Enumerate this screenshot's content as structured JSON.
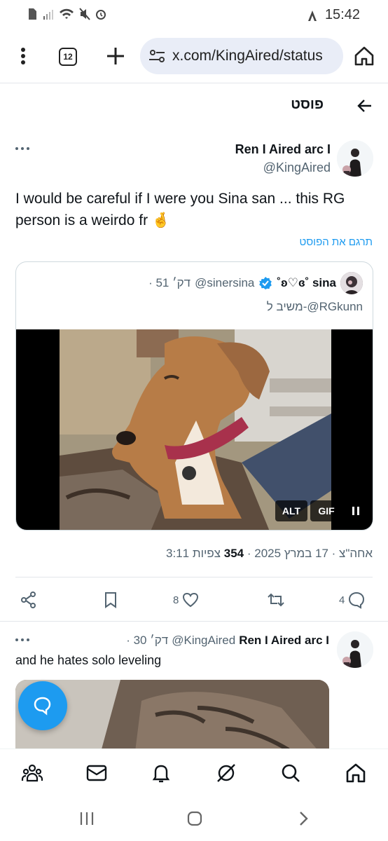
{
  "status_bar": {
    "time": "15:42",
    "icons": [
      "sim-icon",
      "signal-icon",
      "wifi-icon",
      "mute-icon",
      "alarm-icon",
      "autofill-icon"
    ]
  },
  "browser": {
    "tab_count": "12",
    "url": "x.com/KingAired/status",
    "icons": [
      "menu-dots-icon",
      "new-tab-plus-icon",
      "site-settings-icon",
      "home-icon"
    ]
  },
  "post_header": {
    "title": "פוסט",
    "back_icon": "arrow-back-icon"
  },
  "main_tweet": {
    "name": "Ren I Aired arc I",
    "handle": "@KingAired",
    "body": "I would be careful if I were you Sina san ... this RG person is a weirdo fr 🤞",
    "translate": "תרגם את הפוסט",
    "meta_time": "3:11 אחה\"צ · 17 במרץ 2025 · ",
    "views_count": "354",
    "views_label": " צפיות"
  },
  "quote": {
    "name": "sina",
    "name_deco": "˚ʚ♡ɞ˚ ",
    "handle": "@sinersina",
    "time": "· 51 דק׳",
    "reply_to": "משיב ל-@RGkunn",
    "alt_label": "ALT",
    "gif_label": "GIF"
  },
  "actions": {
    "reply_count": "4",
    "retweet_count": "",
    "like_count": "8",
    "bookmark_count": ""
  },
  "reply_tweet": {
    "name": "Ren I Aired arc I",
    "handle": "@KingAired",
    "time": "· 30 דק׳",
    "body": "and he hates solo leveling"
  },
  "colors": {
    "accent": "#1d9bf0",
    "text": "#0f1419",
    "muted": "#536471",
    "url_bar": "#e9edf7"
  },
  "bottom_nav": [
    "communities-icon",
    "messages-icon",
    "notifications-icon",
    "grok-icon",
    "search-icon",
    "home-icon"
  ]
}
